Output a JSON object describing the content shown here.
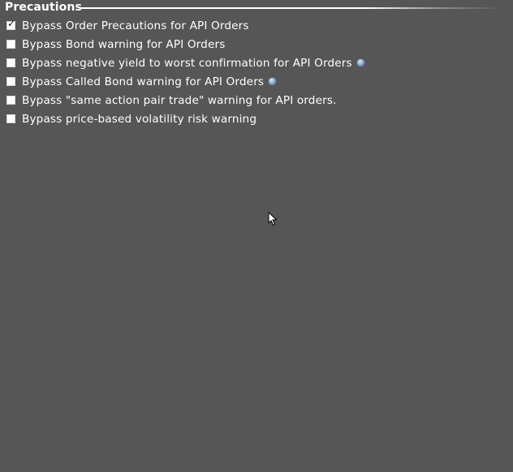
{
  "section": {
    "title": "Precautions"
  },
  "options": [
    {
      "label": "Bypass Order Precautions for API Orders",
      "checked": true,
      "info_icon": false
    },
    {
      "label": "Bypass Bond warning for API Orders",
      "checked": false,
      "info_icon": false
    },
    {
      "label": "Bypass negative yield to worst confirmation for API Orders",
      "checked": false,
      "info_icon": true
    },
    {
      "label": "Bypass Called Bond warning for API Orders",
      "checked": false,
      "info_icon": true
    },
    {
      "label": "Bypass \"same action pair trade\" warning for API orders.",
      "checked": false,
      "info_icon": false
    },
    {
      "label": "Bypass price-based volatility risk warning",
      "checked": false,
      "info_icon": false
    }
  ],
  "icons": {
    "checkmark": "✓",
    "info": "info-icon",
    "cursor": "mouse-pointer-icon"
  },
  "colors": {
    "background": "#565656",
    "text": "#ffffff",
    "info_icon": "#9fb7d8"
  }
}
